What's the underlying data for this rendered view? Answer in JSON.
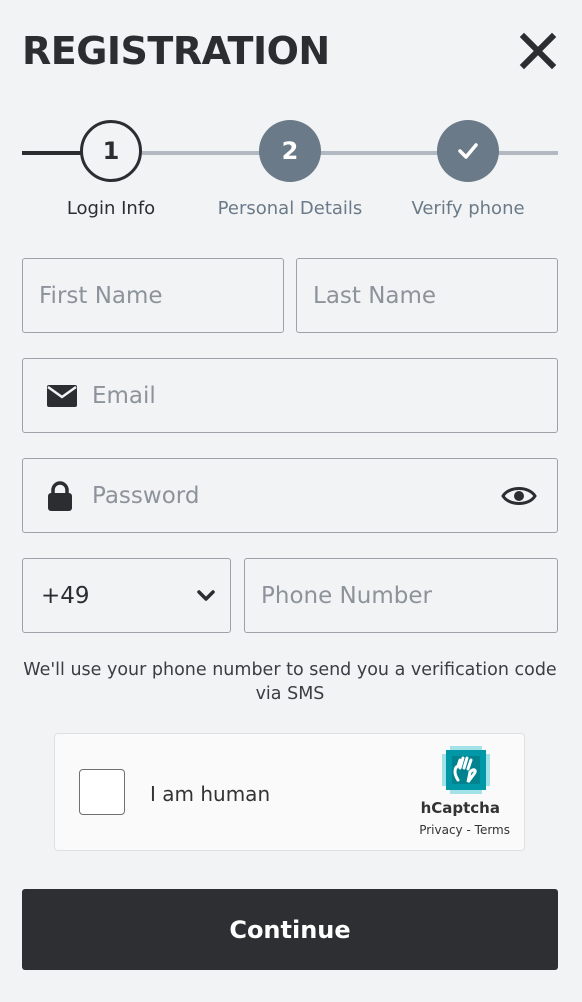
{
  "header": {
    "title": "REGISTRATION"
  },
  "stepper": {
    "steps": [
      {
        "number": "1",
        "label": "Login Info"
      },
      {
        "number": "2",
        "label": "Personal Details"
      },
      {
        "number": "",
        "label": "Verify phone"
      }
    ]
  },
  "form": {
    "first_name": {
      "placeholder": "First Name",
      "value": ""
    },
    "last_name": {
      "placeholder": "Last Name",
      "value": ""
    },
    "email": {
      "placeholder": "Email",
      "value": ""
    },
    "password": {
      "placeholder": "Password",
      "value": ""
    },
    "country_code": {
      "value": "+49"
    },
    "phone": {
      "placeholder": "Phone Number",
      "value": ""
    }
  },
  "info_text": "We'll use your phone number to send you a verification code via SMS",
  "captcha": {
    "label": "I am human",
    "brand": "hCaptcha",
    "privacy_link": "Privacy",
    "separator": "-",
    "terms_link": "Terms"
  },
  "actions": {
    "continue_label": "Continue"
  },
  "colors": {
    "dark": "#2d2f33",
    "step_inactive": "#6b7a88",
    "line_inactive": "#b3b9c1",
    "background": "#f2f3f5"
  },
  "icons": [
    "close-icon",
    "envelope-icon",
    "lock-icon",
    "eye-icon",
    "chevron-down-icon",
    "checkmark-icon",
    "hcaptcha-logo-icon"
  ]
}
